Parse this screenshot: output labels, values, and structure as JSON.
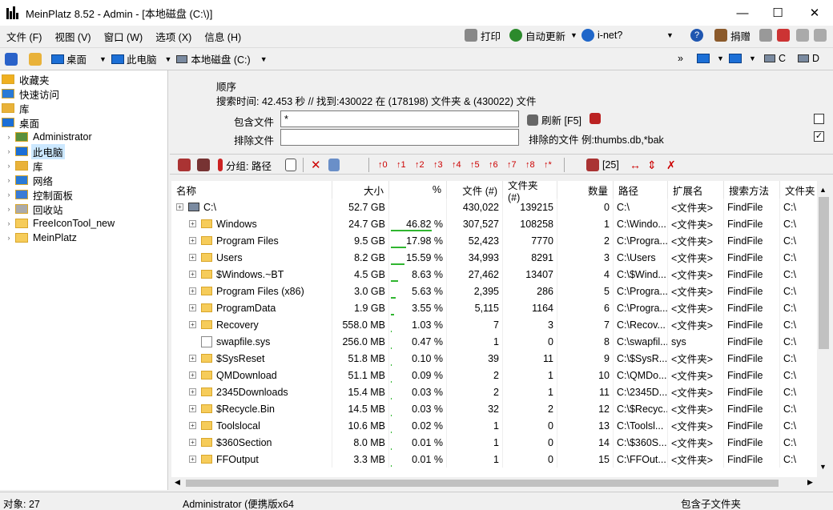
{
  "window": {
    "title": "MeinPlatz 8.52 - Admin - [本地磁盘 (C:\\)]"
  },
  "menu": [
    "文件 (F)",
    "视图 (V)",
    "窗口 (W)",
    "选项 (X)",
    "信息 (H)"
  ],
  "toolbar_right": {
    "print": "打印",
    "autoupdate": "自动更新",
    "inet": "i-net?",
    "donate": "捐赠"
  },
  "address": {
    "desktop": "桌面",
    "thispc": "此电脑",
    "drive": "本地磁盘 (C:)",
    "c": "C",
    "d": "D"
  },
  "tree": [
    {
      "label": "收藏夹",
      "indent": 0
    },
    {
      "label": "快速访问",
      "indent": 0
    },
    {
      "label": "库",
      "indent": 0
    },
    {
      "label": "桌面",
      "indent": 0
    },
    {
      "label": "Administrator",
      "indent": 1
    },
    {
      "label": "此电脑",
      "indent": 1,
      "selected": true
    },
    {
      "label": "库",
      "indent": 1
    },
    {
      "label": "网络",
      "indent": 1
    },
    {
      "label": "控制面板",
      "indent": 1
    },
    {
      "label": "回收站",
      "indent": 1
    },
    {
      "label": "FreeIconTool_new",
      "indent": 1
    },
    {
      "label": "MeinPlatz",
      "indent": 1
    }
  ],
  "search": {
    "order_label": "顺序",
    "status": "搜索时间: 42.453 秒 //  找到:430022 在 (178198) 文件夹 & (430022) 文件",
    "include_label": "包含文件",
    "include_value": "*",
    "exclude_label": "排除文件",
    "exclude_value": "",
    "refresh": "刷新 [F5]",
    "excluded_files": "排除的文件 例:thumbs.db,*bak"
  },
  "toolbar2": {
    "group": "分组: 路径",
    "count": "[25]"
  },
  "columns": [
    "名称",
    "大小",
    "%",
    "文件 (#)",
    "文件夹 (#)",
    "数量",
    "路径",
    "扩展名",
    "搜索方法",
    "文件夹"
  ],
  "rows": [
    {
      "name": "C:\\",
      "size": "52.7 GB",
      "pct": "",
      "pctv": 0,
      "files": "430,022",
      "folders": "139215",
      "count": "0",
      "path": "C:\\",
      "ext": "<文件夹>",
      "method": "FindFile",
      "folder": "C:\\",
      "root": true
    },
    {
      "name": "Windows",
      "size": "24.7 GB",
      "pct": "46.82 %",
      "pctv": 46.82,
      "files": "307,527",
      "folders": "108258",
      "count": "1",
      "path": "C:\\Windo...",
      "ext": "<文件夹>",
      "method": "FindFile",
      "folder": "C:\\"
    },
    {
      "name": "Program Files",
      "size": "9.5 GB",
      "pct": "17.98 %",
      "pctv": 17.98,
      "files": "52,423",
      "folders": "7770",
      "count": "2",
      "path": "C:\\Progra...",
      "ext": "<文件夹>",
      "method": "FindFile",
      "folder": "C:\\"
    },
    {
      "name": "Users",
      "size": "8.2 GB",
      "pct": "15.59 %",
      "pctv": 15.59,
      "files": "34,993",
      "folders": "8291",
      "count": "3",
      "path": "C:\\Users",
      "ext": "<文件夹>",
      "method": "FindFile",
      "folder": "C:\\"
    },
    {
      "name": "$Windows.~BT",
      "size": "4.5 GB",
      "pct": "8.63 %",
      "pctv": 8.63,
      "files": "27,462",
      "folders": "13407",
      "count": "4",
      "path": "C:\\$Wind...",
      "ext": "<文件夹>",
      "method": "FindFile",
      "folder": "C:\\"
    },
    {
      "name": "Program Files (x86)",
      "size": "3.0 GB",
      "pct": "5.63 %",
      "pctv": 5.63,
      "files": "2,395",
      "folders": "286",
      "count": "5",
      "path": "C:\\Progra...",
      "ext": "<文件夹>",
      "method": "FindFile",
      "folder": "C:\\"
    },
    {
      "name": "ProgramData",
      "size": "1.9 GB",
      "pct": "3.55 %",
      "pctv": 3.55,
      "files": "5,115",
      "folders": "1164",
      "count": "6",
      "path": "C:\\Progra...",
      "ext": "<文件夹>",
      "method": "FindFile",
      "folder": "C:\\"
    },
    {
      "name": "Recovery",
      "size": "558.0 MB",
      "pct": "1.03 %",
      "pctv": 1.03,
      "files": "7",
      "folders": "3",
      "count": "7",
      "path": "C:\\Recov...",
      "ext": "<文件夹>",
      "method": "FindFile",
      "folder": "C:\\"
    },
    {
      "name": "swapfile.sys",
      "size": "256.0 MB",
      "pct": "0.47 %",
      "pctv": 0.47,
      "files": "1",
      "folders": "0",
      "count": "8",
      "path": "C:\\swapfil...",
      "ext": "sys",
      "method": "FindFile",
      "folder": "C:\\",
      "file": true
    },
    {
      "name": "$SysReset",
      "size": "51.8 MB",
      "pct": "0.10 %",
      "pctv": 0.1,
      "files": "39",
      "folders": "11",
      "count": "9",
      "path": "C:\\$SysR...",
      "ext": "<文件夹>",
      "method": "FindFile",
      "folder": "C:\\"
    },
    {
      "name": "QMDownload",
      "size": "51.1 MB",
      "pct": "0.09 %",
      "pctv": 0.09,
      "files": "2",
      "folders": "1",
      "count": "10",
      "path": "C:\\QMDo...",
      "ext": "<文件夹>",
      "method": "FindFile",
      "folder": "C:\\"
    },
    {
      "name": "2345Downloads",
      "size": "15.4 MB",
      "pct": "0.03 %",
      "pctv": 0.03,
      "files": "2",
      "folders": "1",
      "count": "11",
      "path": "C:\\2345D...",
      "ext": "<文件夹>",
      "method": "FindFile",
      "folder": "C:\\"
    },
    {
      "name": "$Recycle.Bin",
      "size": "14.5 MB",
      "pct": "0.03 %",
      "pctv": 0.03,
      "files": "32",
      "folders": "2",
      "count": "12",
      "path": "C:\\$Recyc...",
      "ext": "<文件夹>",
      "method": "FindFile",
      "folder": "C:\\"
    },
    {
      "name": "Toolslocal",
      "size": "10.6 MB",
      "pct": "0.02 %",
      "pctv": 0.02,
      "files": "1",
      "folders": "0",
      "count": "13",
      "path": "C:\\Toolsl...",
      "ext": "<文件夹>",
      "method": "FindFile",
      "folder": "C:\\"
    },
    {
      "name": "$360Section",
      "size": "8.0 MB",
      "pct": "0.01 %",
      "pctv": 0.01,
      "files": "1",
      "folders": "0",
      "count": "14",
      "path": "C:\\$360S...",
      "ext": "<文件夹>",
      "method": "FindFile",
      "folder": "C:\\"
    },
    {
      "name": "FFOutput",
      "size": "3.3 MB",
      "pct": "0.01 %",
      "pctv": 0.01,
      "files": "1",
      "folders": "0",
      "count": "15",
      "path": "C:\\FFOut...",
      "ext": "<文件夹>",
      "method": "FindFile",
      "folder": "C:\\"
    }
  ],
  "status": {
    "objects": "对象: 27",
    "user": "Administrator (便携版x64",
    "sub": "包含子文件夹"
  },
  "colors": {
    "selection": "#cce8ff",
    "bar": "#2fb52f",
    "folder": "#f6cc5a"
  }
}
